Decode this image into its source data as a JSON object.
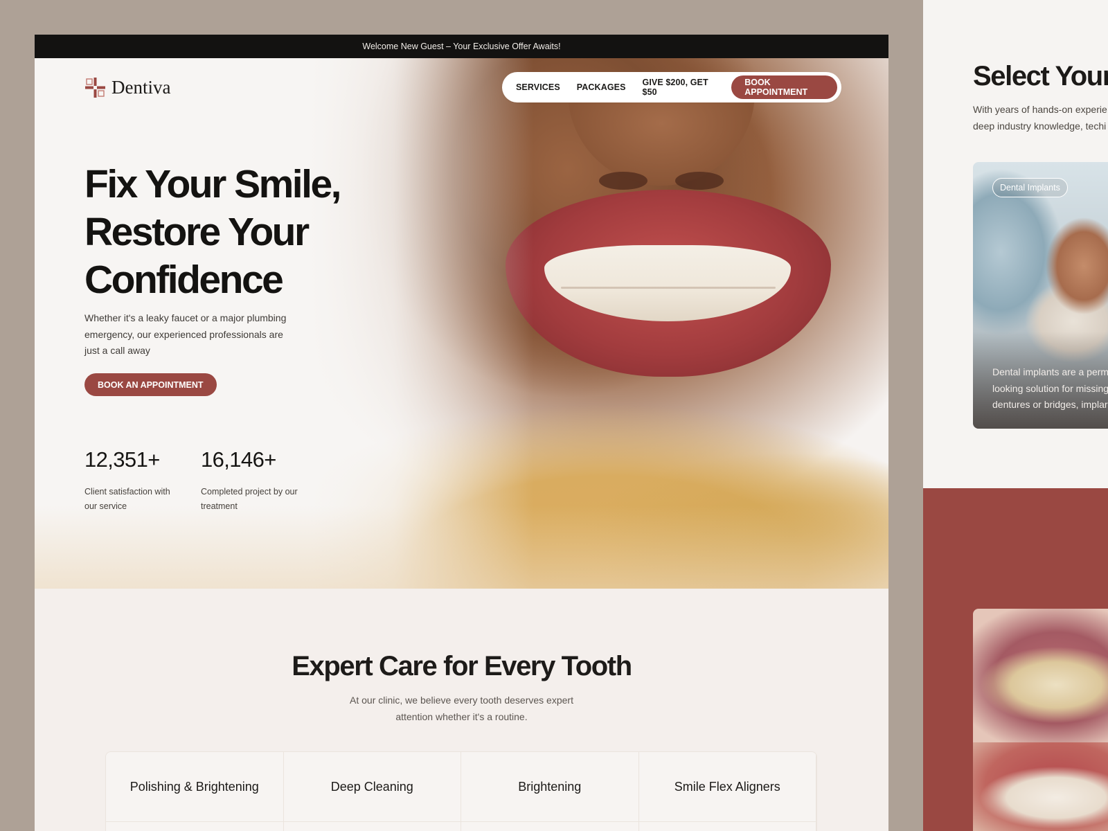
{
  "promo_bar": {
    "text": "Welcome New Guest – Your Exclusive Offer Awaits!"
  },
  "brand": {
    "name": "Dentiva",
    "accent": "#9a4842"
  },
  "nav": {
    "links": [
      "SERVICES",
      "PACKAGES",
      "GIVE $200, GET $50"
    ],
    "cta": "BOOK APPOINTMENT"
  },
  "hero": {
    "title_lines": [
      "Fix Your Smile,",
      "Restore Your",
      "Confidence"
    ],
    "subtitle": "Whether it's a leaky faucet or a major plumbing emergency, our experienced professionals are just a call away",
    "cta": "BOOK AN APPOINTMENT",
    "stats": [
      {
        "value": "12,351+",
        "label": "Client satisfaction with our service"
      },
      {
        "value": "16,146+",
        "label": "Completed project by our treatment"
      }
    ]
  },
  "services": {
    "title": "Expert Care for Every Tooth",
    "subtitle": "At our clinic, we believe every tooth deserves expert attention whether it's a routine.",
    "tabs": [
      "Polishing & Brightening",
      "Deep Cleaning",
      "Brightening",
      "Smile Flex Aligners"
    ]
  },
  "side_panel": {
    "title": "Select Your",
    "subtitle_lines": [
      "With years of hands-on experie",
      "deep industry knowledge, techi"
    ],
    "card": {
      "badge": "Dental Implants",
      "text_lines": [
        "Dental implants are a perm",
        "looking solution for missing",
        "dentures or bridges, implar"
      ]
    }
  }
}
